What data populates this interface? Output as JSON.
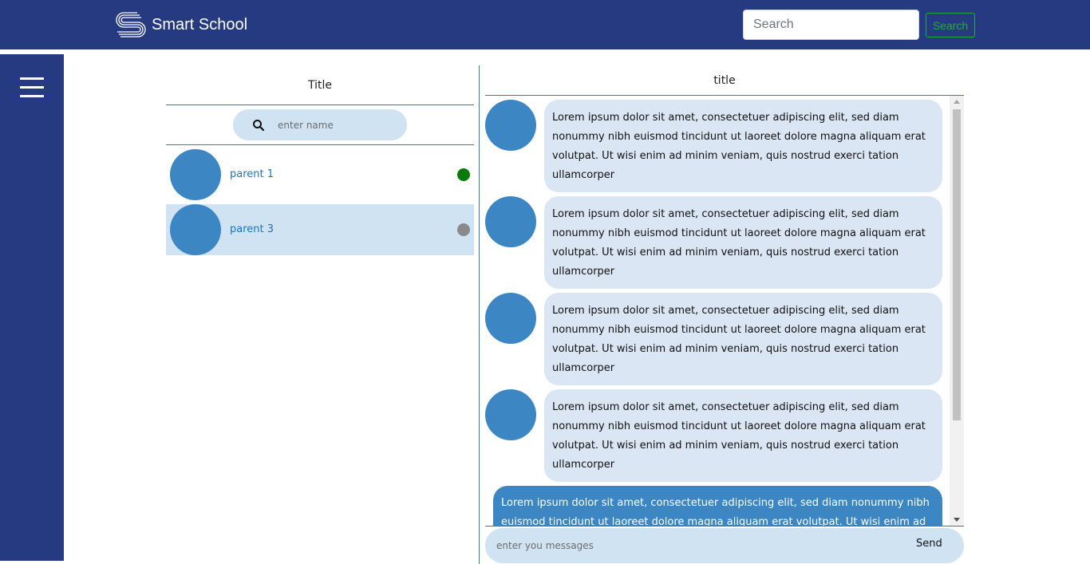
{
  "navbar": {
    "brand_name": "Smart School",
    "brand_icon": "logo-icon",
    "search_placeholder": "Search",
    "search_value": "",
    "search_button_label": "Search",
    "colors": {
      "bar": "#253a80",
      "search_button": "#28a745"
    }
  },
  "sidebar": {
    "menu_icon": "hamburger-menu-icon"
  },
  "contacts": {
    "title": "Title",
    "search_placeholder": "enter name",
    "search_value": "",
    "search_icon": "search-icon",
    "items": [
      {
        "name": "parent 1",
        "status": "online",
        "status_color": "#0a7a0a",
        "selected": false
      },
      {
        "name": "parent 3",
        "status": "offline",
        "status_color": "#8a8a8a",
        "selected": true
      }
    ]
  },
  "chat": {
    "title": "title",
    "messages": [
      {
        "from": "other",
        "text": "Lorem ipsum dolor sit amet, consectetuer adipiscing elit, sed diam nonummy nibh euismod tincidunt ut laoreet dolore magna aliquam erat volutpat. Ut wisi enim ad minim veniam, quis nostrud exerci tation ullamcorper"
      },
      {
        "from": "other",
        "text": "Lorem ipsum dolor sit amet, consectetuer adipiscing elit, sed diam nonummy nibh euismod tincidunt ut laoreet dolore magna aliquam erat volutpat. Ut wisi enim ad minim veniam, quis nostrud exerci tation ullamcorper"
      },
      {
        "from": "other",
        "text": "Lorem ipsum dolor sit amet, consectetuer adipiscing elit, sed diam nonummy nibh euismod tincidunt ut laoreet dolore magna aliquam erat volutpat. Ut wisi enim ad minim veniam, quis nostrud exerci tation ullamcorper"
      },
      {
        "from": "other",
        "text": "Lorem ipsum dolor sit amet, consectetuer adipiscing elit, sed diam nonummy nibh euismod tincidunt ut laoreet dolore magna aliquam erat volutpat. Ut wisi enim ad minim veniam, quis nostrud exerci tation ullamcorper"
      },
      {
        "from": "me",
        "text": "Lorem ipsum dolor sit amet, consectetuer adipiscing elit, sed diam nonummy nibh euismod tincidunt ut laoreet dolore magna aliquam erat volutpat. Ut wisi enim ad"
      }
    ],
    "compose_placeholder": "enter you messages",
    "compose_value": "",
    "send_label": "Send",
    "colors": {
      "bubble_other": "#dae6f3",
      "bubble_me": "#3b86c3",
      "avatar": "#3b86c3"
    }
  }
}
